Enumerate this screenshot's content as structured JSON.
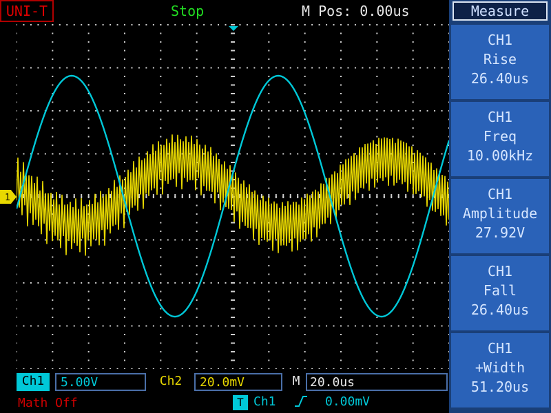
{
  "header": {
    "brand": "UNI-T",
    "status": "Stop",
    "mpos": "M Pos: 0.00us"
  },
  "menu": {
    "title": "Measure",
    "items": [
      {
        "line1": "CH1",
        "line2": "Rise",
        "value": "26.40us"
      },
      {
        "line1": "CH1",
        "line2": "Freq",
        "value": "10.00kHz"
      },
      {
        "line1": "CH1",
        "line2": "Amplitude",
        "value": "27.92V"
      },
      {
        "line1": "CH1",
        "line2": "Fall",
        "value": "26.40us"
      },
      {
        "line1": "CH1",
        "line2": "+Width",
        "value": "51.20us"
      }
    ]
  },
  "footer": {
    "ch1_label": "Ch1",
    "ch1_scale": "5.00V",
    "ch2_label": "Ch2",
    "ch2_scale": "20.0mV",
    "m_label": "M",
    "m_scale": "20.0us",
    "math": "Math Off",
    "trigger_icon": "T",
    "trigger_source": "Ch1",
    "trigger_slope_icon": "rising-edge-icon",
    "trigger_level": "0.00mV"
  },
  "screen": {
    "ch2_marker": "1",
    "colors": {
      "ch1": "#00c8d8",
      "ch2": "#e8d800",
      "grid": "#cfcfcf",
      "background": "#000000",
      "menu": "#2a62b8"
    }
  }
}
